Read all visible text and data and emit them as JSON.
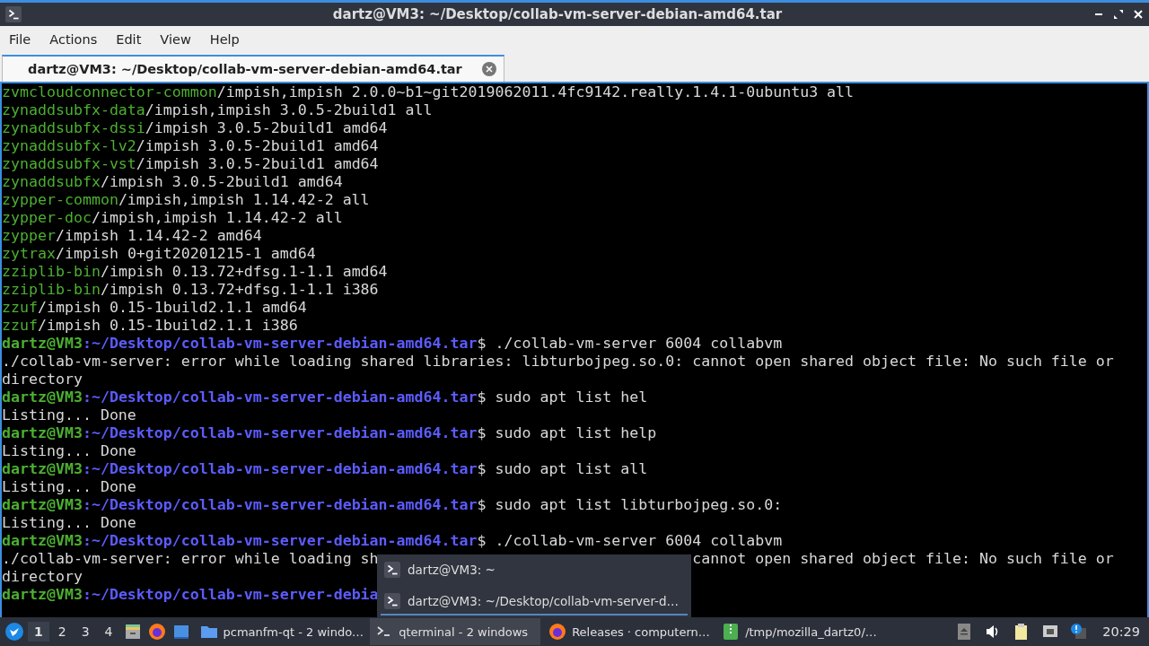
{
  "window": {
    "title": "dartz@VM3: ~/Desktop/collab-vm-server-debian-amd64.tar"
  },
  "menu": [
    "File",
    "Actions",
    "Edit",
    "View",
    "Help"
  ],
  "tabs": [
    {
      "label": "dartz@VM3: ~/Desktop/collab-vm-server-debian-amd64.tar",
      "selected": true
    }
  ],
  "terminal": {
    "lines": [
      [
        {
          "kind": "pkg",
          "text": "zvmcloudconnector-common"
        },
        {
          "kind": "text",
          "text": "/impish,impish 2.0.0~b1~git2019062011.4fc9142.really.1.4.1-0ubuntu3 all"
        }
      ],
      [
        {
          "kind": "pkg",
          "text": "zynaddsubfx-data"
        },
        {
          "kind": "text",
          "text": "/impish,impish 3.0.5-2build1 all"
        }
      ],
      [
        {
          "kind": "pkg",
          "text": "zynaddsubfx-dssi"
        },
        {
          "kind": "text",
          "text": "/impish 3.0.5-2build1 amd64"
        }
      ],
      [
        {
          "kind": "pkg",
          "text": "zynaddsubfx-lv2"
        },
        {
          "kind": "text",
          "text": "/impish 3.0.5-2build1 amd64"
        }
      ],
      [
        {
          "kind": "pkg",
          "text": "zynaddsubfx-vst"
        },
        {
          "kind": "text",
          "text": "/impish 3.0.5-2build1 amd64"
        }
      ],
      [
        {
          "kind": "pkg",
          "text": "zynaddsubfx"
        },
        {
          "kind": "text",
          "text": "/impish 3.0.5-2build1 amd64"
        }
      ],
      [
        {
          "kind": "pkg",
          "text": "zypper-common"
        },
        {
          "kind": "text",
          "text": "/impish,impish 1.14.42-2 all"
        }
      ],
      [
        {
          "kind": "pkg",
          "text": "zypper-doc"
        },
        {
          "kind": "text",
          "text": "/impish,impish 1.14.42-2 all"
        }
      ],
      [
        {
          "kind": "pkg",
          "text": "zypper"
        },
        {
          "kind": "text",
          "text": "/impish 1.14.42-2 amd64"
        }
      ],
      [
        {
          "kind": "pkg",
          "text": "zytrax"
        },
        {
          "kind": "text",
          "text": "/impish 0+git20201215-1 amd64"
        }
      ],
      [
        {
          "kind": "pkg",
          "text": "zziplib-bin"
        },
        {
          "kind": "text",
          "text": "/impish 0.13.72+dfsg.1-1.1 amd64"
        }
      ],
      [
        {
          "kind": "pkg",
          "text": "zziplib-bin"
        },
        {
          "kind": "text",
          "text": "/impish 0.13.72+dfsg.1-1.1 i386"
        }
      ],
      [
        {
          "kind": "pkg",
          "text": "zzuf"
        },
        {
          "kind": "text",
          "text": "/impish 0.15-1build2.1.1 amd64"
        }
      ],
      [
        {
          "kind": "pkg",
          "text": "zzuf"
        },
        {
          "kind": "text",
          "text": "/impish 0.15-1build2.1.1 i386"
        }
      ],
      [
        {
          "kind": "user",
          "text": "dartz@VM3"
        },
        {
          "kind": "path",
          "text": ":~/Desktop/collab-vm-server-debian-amd64.tar"
        },
        {
          "kind": "text",
          "text": "$ ./collab-vm-server 6004 collabvm"
        }
      ],
      [
        {
          "kind": "text",
          "text": "./collab-vm-server: error while loading shared libraries: libturbojpeg.so.0: cannot open shared object file: No such file or"
        }
      ],
      [
        {
          "kind": "text",
          "text": "directory"
        }
      ],
      [
        {
          "kind": "user",
          "text": "dartz@VM3"
        },
        {
          "kind": "path",
          "text": ":~/Desktop/collab-vm-server-debian-amd64.tar"
        },
        {
          "kind": "text",
          "text": "$ sudo apt list hel"
        }
      ],
      [
        {
          "kind": "text",
          "text": "Listing... Done"
        }
      ],
      [
        {
          "kind": "user",
          "text": "dartz@VM3"
        },
        {
          "kind": "path",
          "text": ":~/Desktop/collab-vm-server-debian-amd64.tar"
        },
        {
          "kind": "text",
          "text": "$ sudo apt list help"
        }
      ],
      [
        {
          "kind": "text",
          "text": "Listing... Done"
        }
      ],
      [
        {
          "kind": "user",
          "text": "dartz@VM3"
        },
        {
          "kind": "path",
          "text": ":~/Desktop/collab-vm-server-debian-amd64.tar"
        },
        {
          "kind": "text",
          "text": "$ sudo apt list all"
        }
      ],
      [
        {
          "kind": "text",
          "text": "Listing... Done"
        }
      ],
      [
        {
          "kind": "user",
          "text": "dartz@VM3"
        },
        {
          "kind": "path",
          "text": ":~/Desktop/collab-vm-server-debian-amd64.tar"
        },
        {
          "kind": "text",
          "text": "$ sudo apt list libturbojpeg.so.0:"
        }
      ],
      [
        {
          "kind": "text",
          "text": "Listing... Done"
        }
      ],
      [
        {
          "kind": "user",
          "text": "dartz@VM3"
        },
        {
          "kind": "path",
          "text": ":~/Desktop/collab-vm-server-debian-amd64.tar"
        },
        {
          "kind": "text",
          "text": "$ ./collab-vm-server 6004 collabvm"
        }
      ],
      [
        {
          "kind": "text",
          "text": "./collab-vm-server: error while loading sh"
        },
        {
          "kind": "covered"
        },
        {
          "kind": "text",
          "text": "cannot open shared object file: No such file or"
        }
      ],
      [
        {
          "kind": "text",
          "text": "directory"
        }
      ],
      [
        {
          "kind": "user",
          "text": "dartz@VM3"
        },
        {
          "kind": "path",
          "text": ":~/Desktop/collab-vm-server-debia"
        }
      ]
    ]
  },
  "window_list_popup": [
    {
      "label": "dartz@VM3: ~",
      "selected": false
    },
    {
      "label": "dartz@VM3: ~/Desktop/collab-vm-server-d…",
      "selected": true
    }
  ],
  "taskbar": {
    "desktops": [
      {
        "label": "1",
        "selected": true
      },
      {
        "label": "2",
        "selected": false
      },
      {
        "label": "3",
        "selected": false
      },
      {
        "label": "4",
        "selected": false
      }
    ],
    "tasks": [
      {
        "kind": "folder",
        "label": "pcmanfm-qt - 2 windo…",
        "selected": false
      },
      {
        "kind": "terminal",
        "label": "qterminal - 2 windows",
        "selected": true
      },
      {
        "kind": "browser",
        "label": "Releases · computern…",
        "selected": false
      },
      {
        "kind": "archive",
        "label": "/tmp/mozilla_dartz0/…",
        "selected": false
      }
    ],
    "clock": "20:29"
  }
}
